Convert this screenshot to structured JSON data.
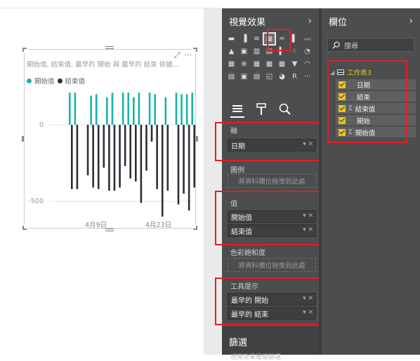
{
  "visual": {
    "title": "開始值, 結束值, 最早的 開始 與 最早的 結束 依據...",
    "focus_icon": "⤢",
    "more_icon": "···",
    "legend": [
      {
        "label": "開始值",
        "color": "#19b3a7"
      },
      {
        "label": "結束值",
        "color": "#2b3035"
      }
    ]
  },
  "chart_data": {
    "type": "bar",
    "yticks": [
      "0",
      "-500"
    ],
    "yvalues": [
      0,
      -500
    ],
    "xticks": [
      "4月9日",
      "4月23日"
    ],
    "ylim": [
      -650,
      220
    ],
    "series": [
      {
        "name": "開始值",
        "color": "#19b3a7",
        "values": [
          210,
          210,
          0,
          0,
          190,
          200,
          0,
          180,
          210,
          0,
          210,
          210,
          180,
          210,
          0,
          210,
          200,
          0,
          180,
          0,
          210,
          200,
          200,
          210
        ]
      },
      {
        "name": "結束值",
        "color": "#2b3035",
        "values": [
          -420,
          -420,
          0,
          -330,
          -410,
          -420,
          -280,
          -430,
          -430,
          -410,
          -270,
          -350,
          -370,
          -510,
          -300,
          -110,
          -420,
          -600,
          -430,
          0,
          -520,
          -450,
          -560,
          -410
        ]
      }
    ]
  },
  "viz_pane": {
    "title": "視覺效果",
    "chevron": "›",
    "icons": [
      "▬",
      "▐",
      "≡",
      "▦",
      "═",
      "▌",
      "〰",
      "▲",
      "▣",
      "▥",
      "▤",
      "▍",
      "⁘",
      "◔",
      "▦",
      "⊕",
      "▦",
      "▦",
      "▦",
      "▼",
      "◠",
      "▤",
      "▣",
      "▤",
      "◱",
      "◕",
      "R",
      "···"
    ],
    "selected_index": 3,
    "sections": {
      "axis": "軸",
      "legend": "圖例",
      "values": "值",
      "saturation": "色彩飽和度",
      "tooltip": "工具提示"
    },
    "axis_wells": [
      "日期"
    ],
    "values_wells": [
      "開始值",
      "結束值"
    ],
    "tooltip_wells": [
      "最早的 開始",
      "最早的 結束"
    ],
    "drop_placeholder": "將資料欄位拖曳到此處",
    "filters_title": "篩選",
    "filters_sub": "視覺效果層級篩選"
  },
  "fields_pane": {
    "title": "欄位",
    "chevron": "›",
    "search_placeholder": "搜尋",
    "table": "工作表3",
    "fields": [
      {
        "label": "日期",
        "sigma": false
      },
      {
        "label": "結束",
        "sigma": false
      },
      {
        "label": "結束值",
        "sigma": true
      },
      {
        "label": "開始",
        "sigma": false
      },
      {
        "label": "開始值",
        "sigma": true
      }
    ]
  }
}
